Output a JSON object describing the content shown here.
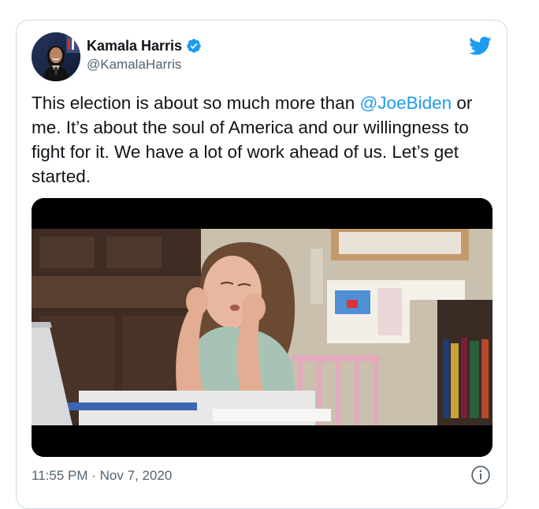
{
  "tweet": {
    "author": {
      "display_name": "Kamala Harris",
      "handle": "@KamalaHarris",
      "verified": true,
      "avatar_icon": "profile-photo"
    },
    "text": {
      "part1": "This election is about so much more than ",
      "mention": "@JoeBiden",
      "part2": " or me. It’s about the soul of America and our willingness to fight for it. We have a lot of work ahead of us. Let’s get started."
    },
    "media": {
      "type": "video",
      "poster_icon": "video-still-girl-at-desk"
    },
    "timestamp": "11:55 PM · Nov 7, 2020",
    "icons": {
      "brand": "twitter-bird-icon",
      "verified": "verified-badge-icon",
      "info": "info-icon"
    },
    "colors": {
      "accent": "#1d9bf0",
      "text": "#0f1419",
      "secondary": "#536471",
      "border": "#cfd9de"
    }
  }
}
